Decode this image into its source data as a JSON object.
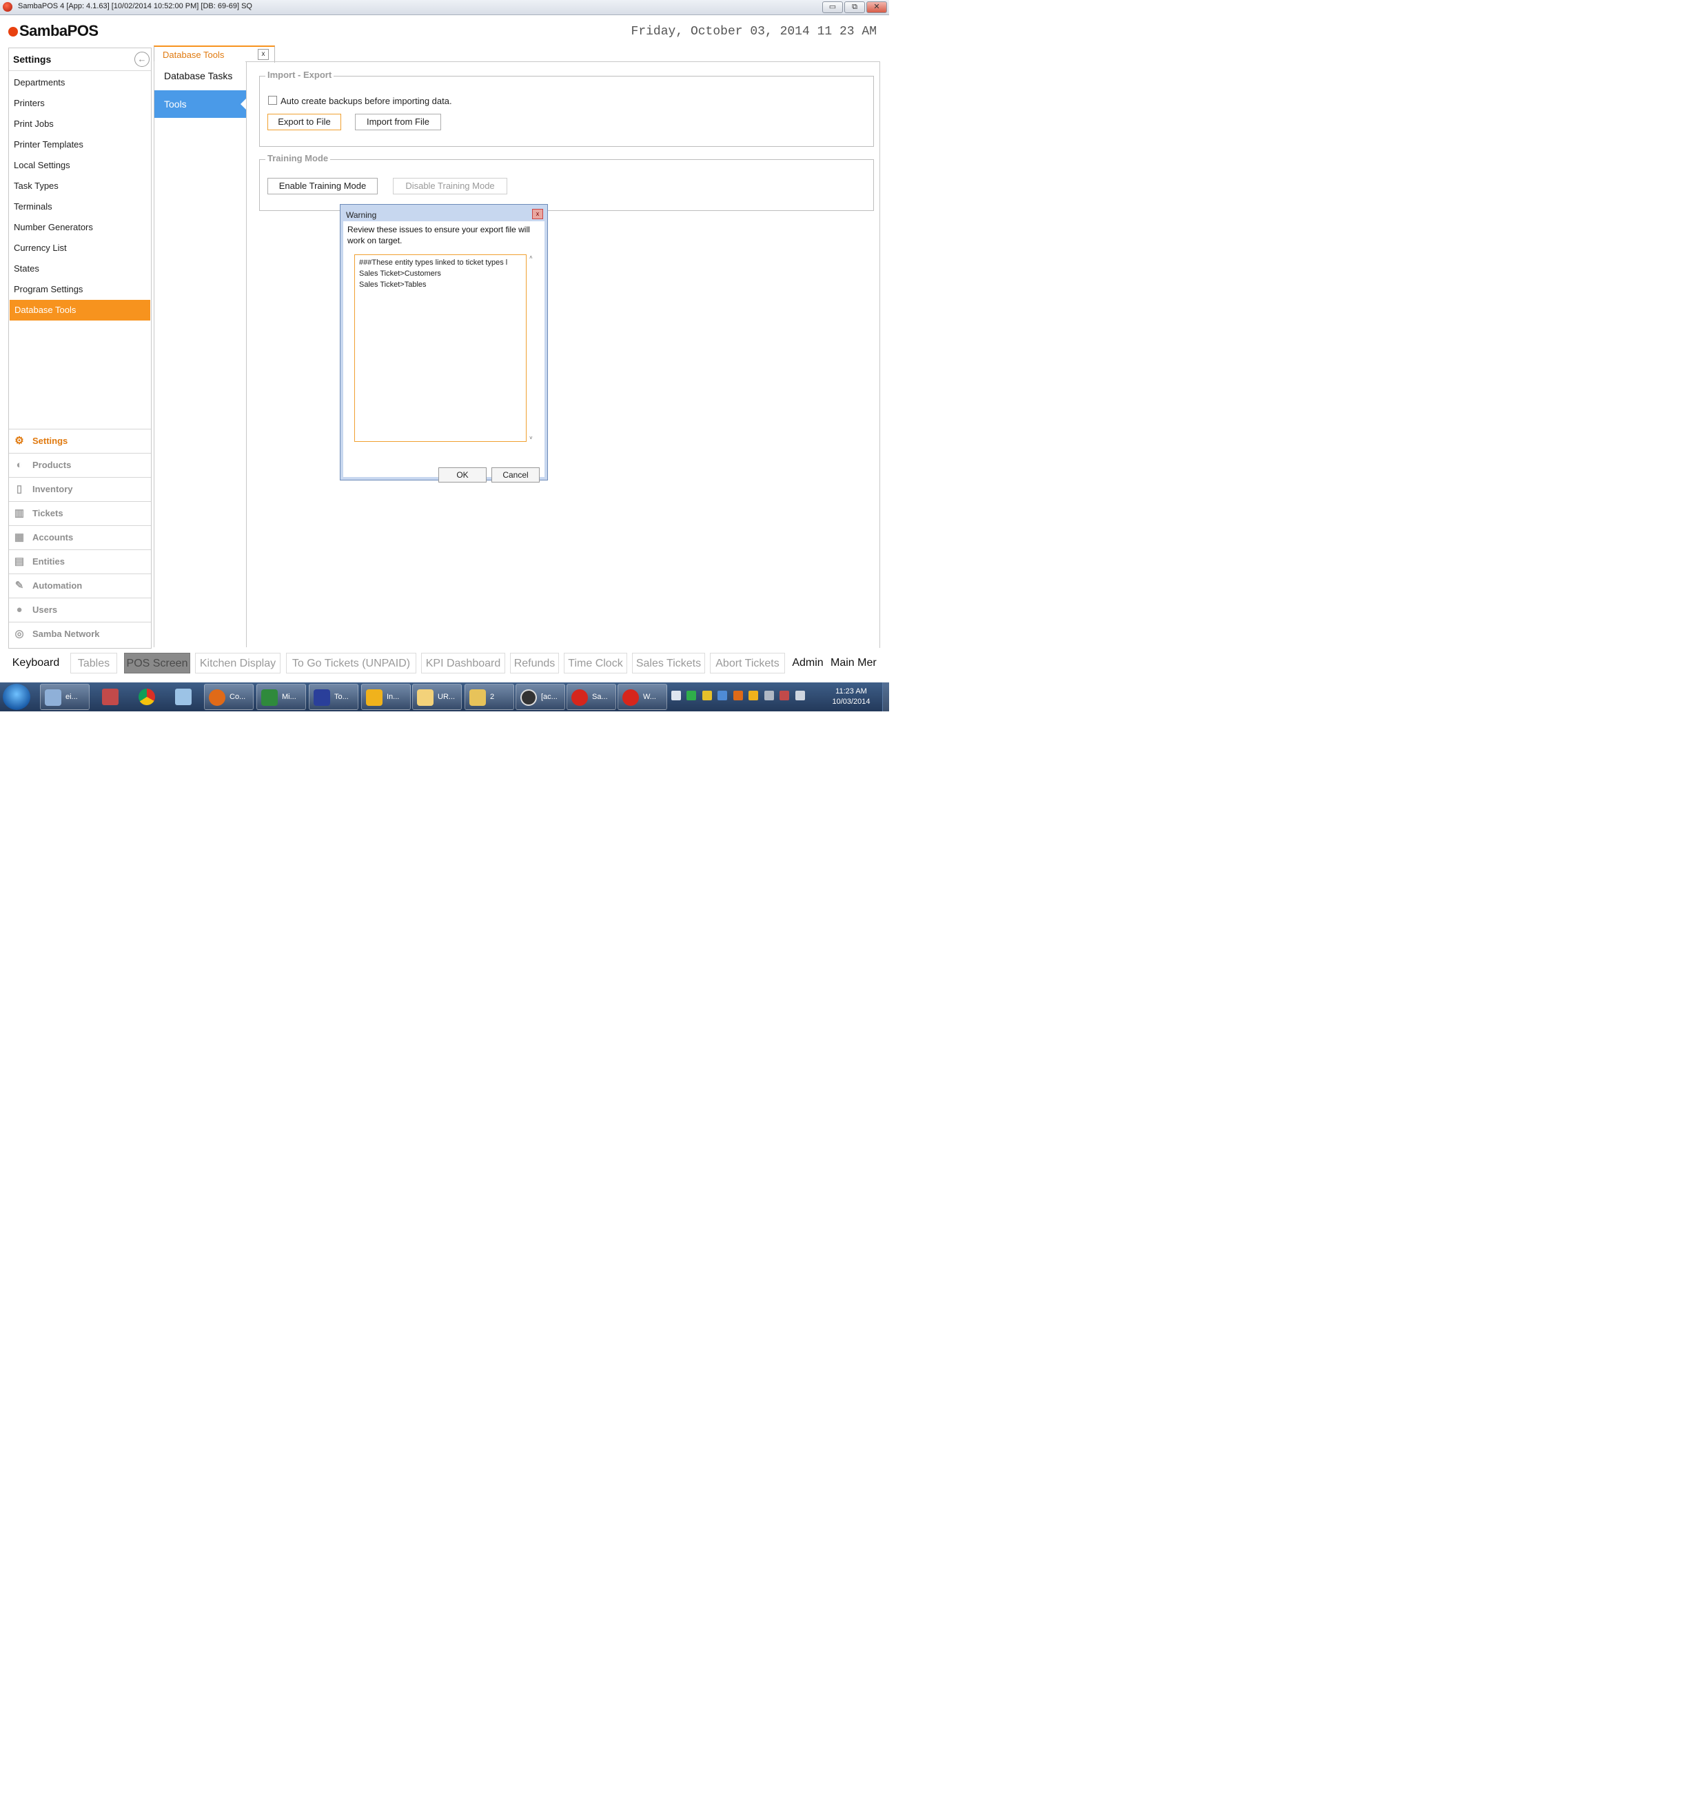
{
  "window": {
    "title": "SambaPOS 4 [App: 4.1.63] [10/02/2014 10:52:00 PM] [DB: 69-69] SQ",
    "minimize": "▭",
    "restore": "⧉",
    "close": "✕"
  },
  "header": {
    "logo": "SambaPOS",
    "datetime": "Friday, October 03, 2014 11 23 AM"
  },
  "sidebar": {
    "title": "Settings",
    "back_glyph": "←",
    "items": [
      {
        "label": "Departments"
      },
      {
        "label": "Printers"
      },
      {
        "label": "Print Jobs"
      },
      {
        "label": "Printer Templates"
      },
      {
        "label": "Local Settings"
      },
      {
        "label": "Task Types"
      },
      {
        "label": "Terminals"
      },
      {
        "label": "Number Generators"
      },
      {
        "label": "Currency List"
      },
      {
        "label": "States"
      },
      {
        "label": "Program Settings"
      },
      {
        "label": "Database Tools",
        "active": true
      }
    ],
    "nav": [
      {
        "label": "Settings",
        "icon": "gear-icon",
        "glyph": "⚙",
        "active": true
      },
      {
        "label": "Products",
        "icon": "products-icon",
        "glyph": "◐"
      },
      {
        "label": "Inventory",
        "icon": "inventory-icon",
        "glyph": "▯"
      },
      {
        "label": "Tickets",
        "icon": "tickets-icon",
        "glyph": "▥"
      },
      {
        "label": "Accounts",
        "icon": "calculator-icon",
        "glyph": "▦"
      },
      {
        "label": "Entities",
        "icon": "entities-icon",
        "glyph": "▤"
      },
      {
        "label": "Automation",
        "icon": "pencil-icon",
        "glyph": "✎"
      },
      {
        "label": "Users",
        "icon": "user-icon",
        "glyph": "●"
      },
      {
        "label": "Samba Network",
        "icon": "globe-icon",
        "glyph": "◎"
      }
    ]
  },
  "document_tab": {
    "label": "Database Tools",
    "close": "x"
  },
  "subnav": {
    "items": [
      {
        "label": "Database Tasks"
      },
      {
        "label": "Tools",
        "active": true
      }
    ]
  },
  "import_export": {
    "title": "Import - Export",
    "auto_backup_label": "Auto create backups before importing data.",
    "auto_backup_checked": false,
    "export_button": "Export to File",
    "import_button": "Import from File"
  },
  "training_mode": {
    "title": "Training Mode",
    "enable_button": "Enable Training Mode",
    "disable_button": "Disable Training Mode"
  },
  "warning_dialog": {
    "title": "Warning",
    "close": "x",
    "message": "Review these issues to ensure your export file will work on target.",
    "lines": [
      "###These entity types linked to ticket types l",
      "Sales Ticket>Customers",
      "Sales Ticket>Tables"
    ],
    "scroll_up": "˄",
    "scroll_down": "˅",
    "ok_button": "OK",
    "cancel_button": "Cancel"
  },
  "bottom_bar": [
    {
      "label": "Keyboard",
      "style": "plain"
    },
    {
      "label": "Tables",
      "style": "dim"
    },
    {
      "label": "POS Screen",
      "style": "dark"
    },
    {
      "label": "Kitchen Display",
      "style": "dim"
    },
    {
      "label": "To Go Tickets (UNPAID)",
      "style": "dim"
    },
    {
      "label": "KPI Dashboard",
      "style": "dim"
    },
    {
      "label": "Refunds",
      "style": "dim"
    },
    {
      "label": "Time Clock",
      "style": "dim"
    },
    {
      "label": "Sales Tickets",
      "style": "dim"
    },
    {
      "label": "Abort Tickets",
      "style": "dim"
    },
    {
      "label": "Admin",
      "style": "plain"
    },
    {
      "label": "Main Mer",
      "style": "plain"
    }
  ],
  "taskbar": {
    "items": [
      {
        "label": "ei...",
        "icon": "paint-icon",
        "color": "#8fb0d8"
      },
      {
        "label": "",
        "icon": "network-icon",
        "color": "#c24a4a"
      },
      {
        "label": "",
        "icon": "chrome-icon",
        "color": "#e2b21c"
      },
      {
        "label": "",
        "icon": "notepad-icon",
        "color": "#9cc3e6"
      },
      {
        "label": "Co...",
        "icon": "firefox-icon",
        "color": "#e06a18"
      },
      {
        "label": "Mi...",
        "icon": "excel-icon",
        "color": "#2f8a3c"
      },
      {
        "label": "To...",
        "icon": "floppy-icon",
        "color": "#2a3f9a"
      },
      {
        "label": "In...",
        "icon": "outlook-icon",
        "color": "#f0b21c"
      },
      {
        "label": "UR...",
        "icon": "mail-icon",
        "color": "#f3d27a"
      },
      {
        "label": "2",
        "icon": "folder-icon",
        "color": "#e7c35a"
      },
      {
        "label": "[ac...",
        "icon": "obs-icon",
        "color": "#333333"
      },
      {
        "label": "Sa...",
        "icon": "sambapos-icon",
        "color": "#d6261c"
      },
      {
        "label": "W...",
        "icon": "sambapos-icon",
        "color": "#d6261c"
      }
    ],
    "clock_time": "11:23 AM",
    "clock_date": "10/03/2014"
  }
}
